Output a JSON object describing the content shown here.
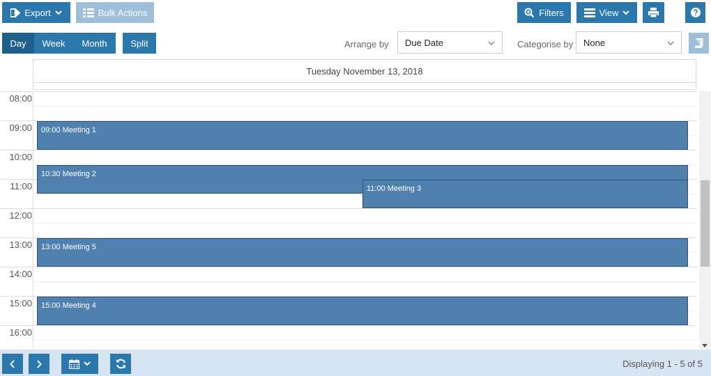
{
  "toolbar": {
    "export_label": "Export",
    "bulk_actions_label": "Bulk Actions",
    "filters_label": "Filters",
    "view_label": "View"
  },
  "view_tabs": {
    "day": "Day",
    "week": "Week",
    "month": "Month",
    "split": "Split",
    "active": "Day"
  },
  "arrange": {
    "label": "Arrange by",
    "value": "Due Date"
  },
  "categorise": {
    "label": "Categorise by",
    "value": "None"
  },
  "calendar": {
    "date_header": "Tuesday November 13, 2018",
    "hours": [
      "08:00",
      "09:00",
      "10:00",
      "11:00",
      "12:00",
      "13:00",
      "14:00",
      "15:00",
      "16:00"
    ],
    "events": [
      {
        "label": "09:00 Meeting 1",
        "start": "09:00",
        "end": "10:00"
      },
      {
        "label": "10:30 Meeting 2",
        "start": "10:30",
        "end": "11:30"
      },
      {
        "label": "11:00 Meeting 3",
        "start": "11:00",
        "end": "12:00"
      },
      {
        "label": "13:00 Meeting 5",
        "start": "13:00",
        "end": "14:00"
      },
      {
        "label": "15:00 Meeting 4",
        "start": "15:00",
        "end": "16:00"
      }
    ]
  },
  "footer": {
    "status": "Displaying 1 - 5 of 5"
  },
  "colors": {
    "primary": "#2b78ad",
    "event": "#5080ad",
    "footer_bg": "#d7e4f1"
  }
}
